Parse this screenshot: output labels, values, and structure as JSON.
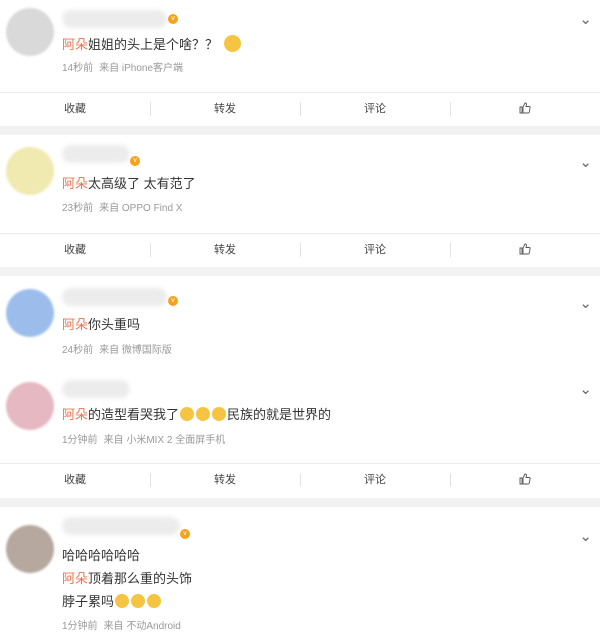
{
  "actions": {
    "favorite": "收藏",
    "repost": "转发",
    "comment": "评论"
  },
  "comments": [
    {
      "avatar_color": "#d9d9d9",
      "mention": "阿朵",
      "text": "姐姐的头上是个啥？？",
      "time": "14秒前",
      "source": "来自 iPhone客户端",
      "has_actions": true
    },
    {
      "avatar_color": "#f0eab0",
      "mention": "阿朵",
      "text": "太高级了 太有范了",
      "time": "23秒前",
      "source": "来自 OPPO Find X",
      "has_actions": true
    },
    {
      "avatar_color": "#9cbdec",
      "mention": "阿朵",
      "text": "你头重吗",
      "time": "24秒前",
      "source": "来自 微博国际版",
      "has_actions": false
    },
    {
      "avatar_color": "#e6b8c1",
      "mention": "阿朵",
      "text_before": "的造型看哭我了",
      "text_after": "民族的就是世界的",
      "time": "1分钟前",
      "source": "来自 小米MIX 2 全面屏手机",
      "has_actions": true
    },
    {
      "avatar_color": "#b6a89f",
      "line1": "哈哈哈哈哈哈",
      "mention": "阿朵",
      "line2": "顶着那么重的头饰",
      "line3": "脖子累吗",
      "time": "1分钟前",
      "source": "来自 不动Android",
      "has_actions": false
    }
  ]
}
